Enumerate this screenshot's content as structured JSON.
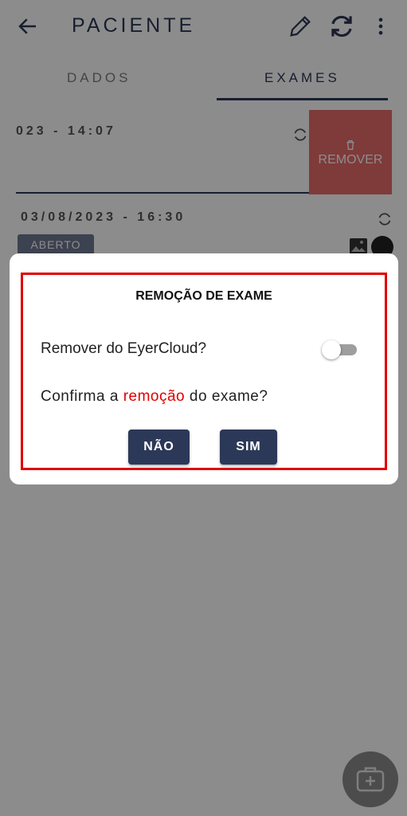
{
  "appbar": {
    "title": "PACIENTE"
  },
  "tabs": [
    {
      "label": "DADOS"
    },
    {
      "label": "EXAMES"
    }
  ],
  "exams": [
    {
      "date": "023 - 14:07",
      "action_label": "REMOVER"
    },
    {
      "date": "03/08/2023 - 16:30",
      "status": "ABERTO"
    }
  ],
  "dialog": {
    "title": "REMOÇÃO DE EXAME",
    "remove_cloud_label": "Remover do EyerCloud?",
    "toggle_on": false,
    "confirm_prefix": "Confirma a ",
    "confirm_highlight": "remoção",
    "confirm_suffix": " do exame?",
    "no_label": "NÃO",
    "yes_label": "SIM"
  },
  "colors": {
    "primary": "#2c3857",
    "danger": "#e76a6a",
    "highlight": "#e00000"
  }
}
